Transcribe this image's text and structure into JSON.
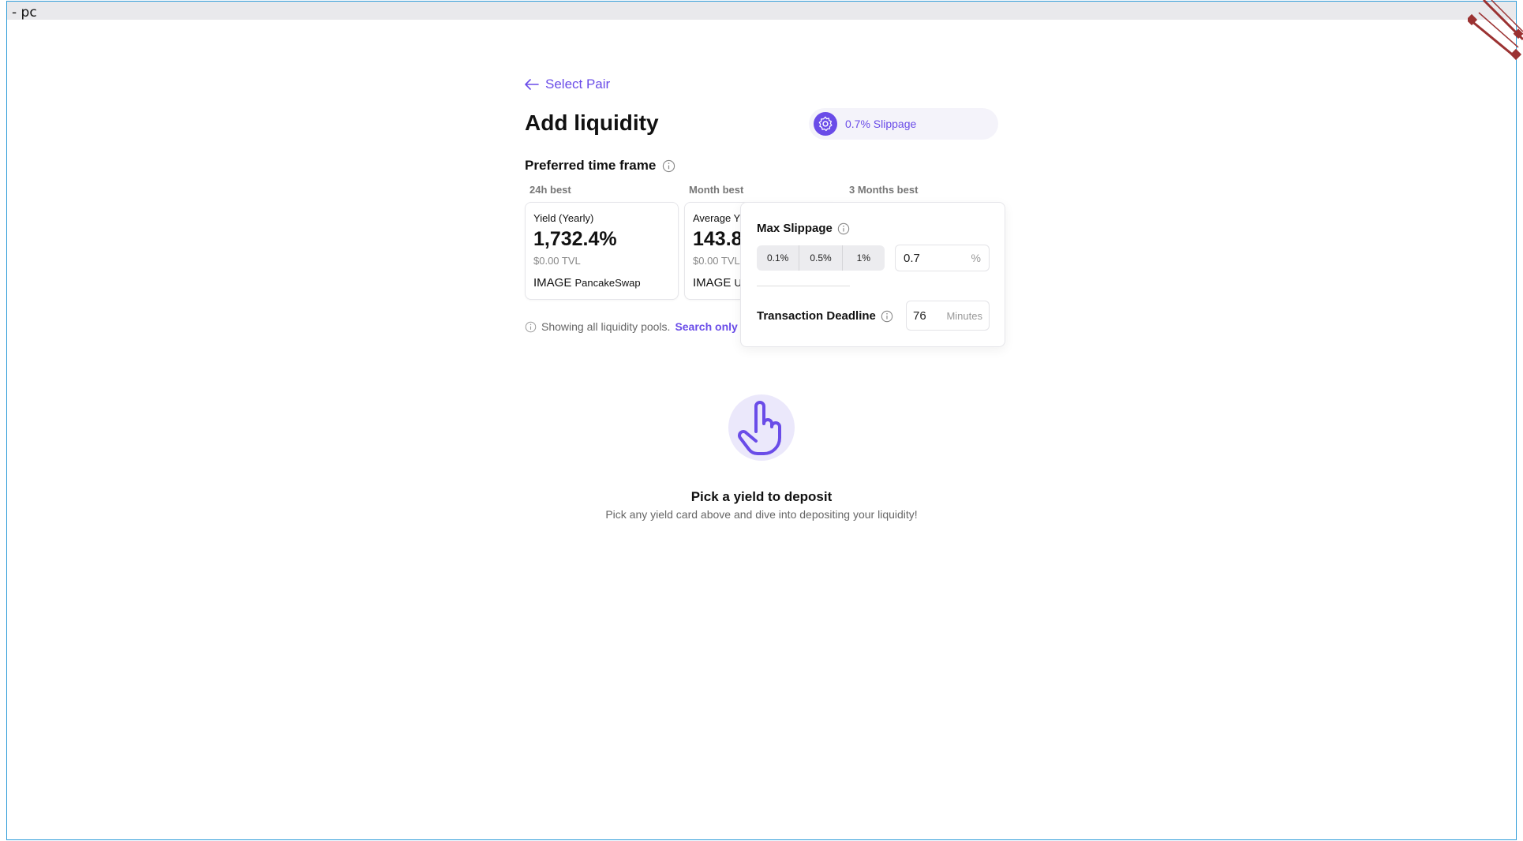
{
  "window": {
    "title": "- pc"
  },
  "nav": {
    "back_label": "Select Pair"
  },
  "page": {
    "title": "Add liquidity"
  },
  "slippage_pill": {
    "label": "0.7% Slippage"
  },
  "timeframe": {
    "title": "Preferred time frame",
    "tabs": [
      {
        "label": "24h best"
      },
      {
        "label": "Month best"
      },
      {
        "label": "3 Months best"
      }
    ]
  },
  "cards": [
    {
      "label": "Yield (Yearly)",
      "value": "1,732.4%",
      "tvl": "$0.00 TVL",
      "image_text": "IMAGE",
      "source": "PancakeSwap"
    },
    {
      "label": "Average Y",
      "value": "143.8",
      "tvl": "$0.00 TVL",
      "image_text": "IMAGE",
      "source": "U"
    }
  ],
  "info": {
    "text": "Showing all liquidity pools.",
    "link": "Search only"
  },
  "slippage_popover": {
    "title": "Max Slippage",
    "options": [
      "0.1%",
      "0.5%",
      "1%"
    ],
    "value": "0.7",
    "unit": "%",
    "deadline_label": "Transaction Deadline",
    "deadline_value": "76",
    "deadline_unit": "Minutes"
  },
  "empty_state": {
    "title": "Pick a yield to deposit",
    "subtitle": "Pick any yield card above and dive into depositing your liquidity!"
  },
  "colors": {
    "accent": "#6a4ce8",
    "frame_border": "#2b9ad8",
    "titlebar": "#e9e9ec",
    "corner_deco": "#9b3232"
  }
}
